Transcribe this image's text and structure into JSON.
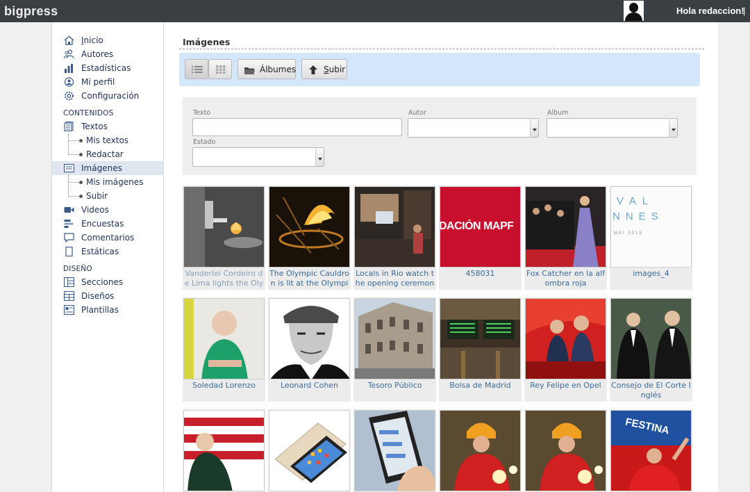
{
  "header": {
    "brand": "bigpress",
    "greeting": "Hola redaccion!",
    "separator": "|"
  },
  "sidebar": {
    "items": [
      {
        "label": "Inicio",
        "icon": "home-icon"
      },
      {
        "label": "Autores",
        "icon": "authors-icon"
      },
      {
        "label": "Estadísticas",
        "icon": "stats-icon"
      },
      {
        "label": "Mi perfil",
        "icon": "profile-icon"
      },
      {
        "label": "Configuración",
        "icon": "settings-icon"
      }
    ],
    "contenidos_label": "CONTENIDOS",
    "textos": {
      "label": "Textos",
      "sub": [
        "Mis textos",
        "Redactar"
      ]
    },
    "imagenes": {
      "label": "Imágenes",
      "sub": [
        "Mis imágenes",
        "Subir"
      ]
    },
    "more": [
      {
        "label": "Videos",
        "icon": "video-icon"
      },
      {
        "label": "Encuestas",
        "icon": "poll-icon"
      },
      {
        "label": "Comentarios",
        "icon": "comment-icon"
      },
      {
        "label": "Estáticas",
        "icon": "page-icon"
      }
    ],
    "diseno_label": "DISEÑO",
    "diseno": [
      {
        "label": "Secciones",
        "icon": "sections-icon"
      },
      {
        "label": "Diseños",
        "icon": "layouts-icon"
      },
      {
        "label": "Plantillas",
        "icon": "templates-icon"
      }
    ]
  },
  "main": {
    "title": "Imágenes",
    "toolbar": {
      "albums": "Álbumes",
      "upload": "Subir"
    },
    "filters": {
      "texto_label": "Texto",
      "texto_value": "",
      "autor_label": "Autor",
      "autor_value": "",
      "album_label": "Album",
      "album_value": "",
      "estado_label": "Estado",
      "estado_value": ""
    },
    "images": [
      {
        "caption": "Vanderlei Cordeiro de Lima lights the Olym",
        "faded": true
      },
      {
        "caption": "The Olympic Cauldron is lit at the Olympic"
      },
      {
        "caption": "Locals in Rio watch the opening ceremony"
      },
      {
        "caption": "458031"
      },
      {
        "caption": "Fox Catcher en la alfombra roja"
      },
      {
        "caption": "images_4"
      },
      {
        "caption": "Soledad Lorenzo"
      },
      {
        "caption": "Leonard Cohen"
      },
      {
        "caption": "Tesoro Público"
      },
      {
        "caption": "Bolsa de Madrid"
      },
      {
        "caption": "Rey Felipe en Opel"
      },
      {
        "caption": "Consejo de El Corte Inglés"
      },
      {
        "caption": ""
      },
      {
        "caption": ""
      },
      {
        "caption": ""
      },
      {
        "caption": ""
      },
      {
        "caption": ""
      },
      {
        "caption": ""
      }
    ],
    "thumb_text": {
      "fundacion": "DACIÓN MAPF",
      "val_top": "VAL",
      "val_mid": "NNES",
      "val_date": "MAI 2015",
      "festina": "FESTINA"
    }
  },
  "colors": {
    "topbar": "#3a3f44",
    "link": "#1e2f58",
    "caption": "#3a6a9a",
    "toolbar_bg": "#d4e6fb",
    "active_nav": "#dfe6f0"
  }
}
